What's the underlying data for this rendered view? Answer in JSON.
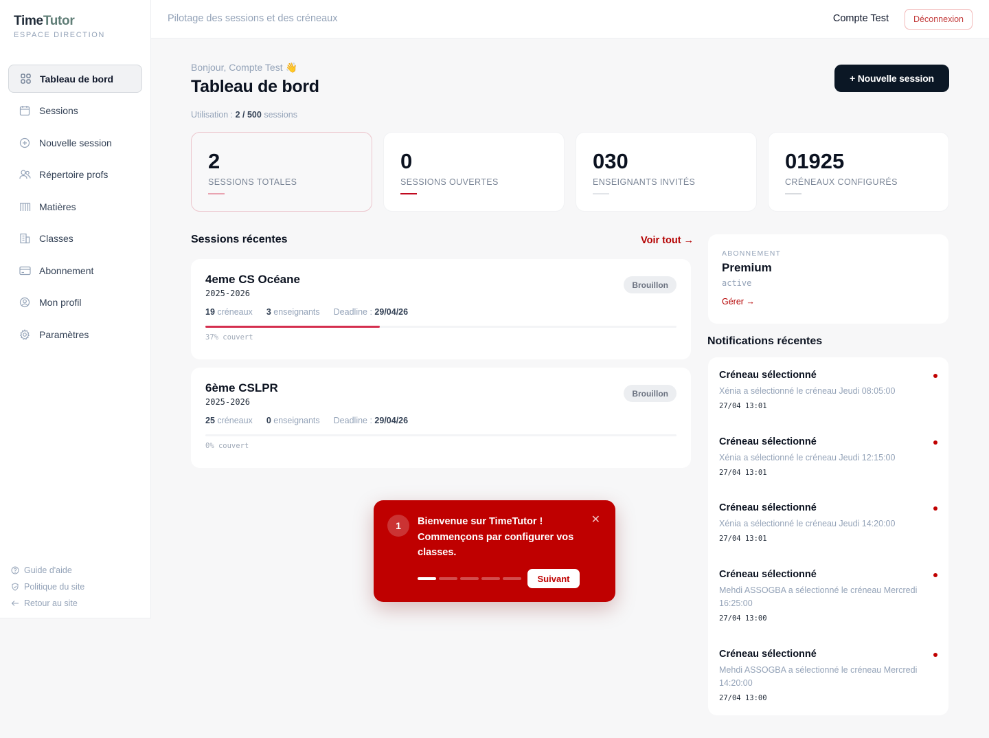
{
  "brand": {
    "name_a": "Time",
    "name_b": "Tutor",
    "subtitle": "ESPACE DIRECTION"
  },
  "sidebar": {
    "items": [
      {
        "label": "Tableau de bord",
        "icon": "grid-icon",
        "active": true
      },
      {
        "label": "Sessions",
        "icon": "calendar-icon"
      },
      {
        "label": "Nouvelle session",
        "icon": "plus-circle-icon"
      },
      {
        "label": "Répertoire profs",
        "icon": "users-icon"
      },
      {
        "label": "Matières",
        "icon": "books-icon"
      },
      {
        "label": "Classes",
        "icon": "building-icon"
      },
      {
        "label": "Abonnement",
        "icon": "credit-card-icon"
      },
      {
        "label": "Mon profil",
        "icon": "user-circle-icon"
      },
      {
        "label": "Paramètres",
        "icon": "gear-icon"
      }
    ],
    "footer": [
      {
        "label": "Guide d'aide",
        "icon": "help-icon"
      },
      {
        "label": "Politique du site",
        "icon": "shield-icon"
      },
      {
        "label": "Retour au site",
        "icon": "arrow-left-icon"
      }
    ]
  },
  "topbar": {
    "title": "Pilotage des sessions et des créneaux",
    "user": "Compte Test",
    "logout": "Déconnexion"
  },
  "header": {
    "greeting": "Bonjour, Compte Test 👋",
    "title": "Tableau de bord",
    "usage_prefix": "Utilisation : ",
    "usage_value": "2 / 500",
    "usage_suffix": " sessions",
    "new_session": "+ Nouvelle session"
  },
  "stats": [
    {
      "value": "2",
      "label": "SESSIONS TOTALES",
      "accent": "#e9a4b1"
    },
    {
      "value": "0",
      "label": "SESSIONS OUVERTES",
      "accent": "#c0091f"
    },
    {
      "value": "030",
      "label": "ENSEIGNANTS INVITÉS",
      "accent": "#e2e5e9"
    },
    {
      "value": "01925",
      "label": "CRÉNEAUX CONFIGURÉS",
      "accent": "#d8dbdf"
    }
  ],
  "recent": {
    "title": "Sessions récentes",
    "see_all": "Voir tout →",
    "sessions": [
      {
        "name": "4eme CS Océane",
        "year": "2025-2026",
        "slots": "19",
        "slots_label": " créneaux",
        "teachers": "3",
        "teachers_label": " enseignants",
        "deadline_label": "Deadline : ",
        "deadline": "29/04/26",
        "coverage": 0.37,
        "coverage_label": "37% couvert",
        "status": "Brouillon"
      },
      {
        "name": "6ème CSLPR",
        "year": "2025-2026",
        "slots": "25",
        "slots_label": " créneaux",
        "teachers": "0",
        "teachers_label": " enseignants",
        "deadline_label": "Deadline : ",
        "deadline": "29/04/26",
        "coverage": 0,
        "coverage_label": "0% couvert",
        "status": "Brouillon"
      }
    ]
  },
  "subscription": {
    "kicker": "ABONNEMENT",
    "plan": "Premium",
    "status": "active",
    "manage": "Gérer →"
  },
  "notifications": {
    "title": "Notifications récentes",
    "items": [
      {
        "title": "Créneau sélectionné",
        "body": "Xénia a sélectionné le créneau Jeudi 08:05:00",
        "time": "27/04 13:01"
      },
      {
        "title": "Créneau sélectionné",
        "body": "Xénia a sélectionné le créneau Jeudi 12:15:00",
        "time": "27/04 13:01"
      },
      {
        "title": "Créneau sélectionné",
        "body": "Xénia a sélectionné le créneau Jeudi 14:20:00",
        "time": "27/04 13:01"
      },
      {
        "title": "Créneau sélectionné",
        "body": "Mehdi ASSOGBA a sélectionné le créneau Mercredi 16:25:00",
        "time": "27/04 13:00"
      },
      {
        "title": "Créneau sélectionné",
        "body": "Mehdi ASSOGBA a sélectionné le créneau Mercredi 14:20:00",
        "time": "27/04 13:00"
      }
    ]
  },
  "tour": {
    "step": "1",
    "text": "Bienvenue sur TimeTutor ! Commençons par configurer vos classes.",
    "next": "Suivant",
    "close": "✕",
    "steps_total": 5,
    "current": 1
  },
  "colors": {
    "brand_red": "#bf0000",
    "dark": "#0b1725",
    "accent_green": "#5f7d76"
  }
}
